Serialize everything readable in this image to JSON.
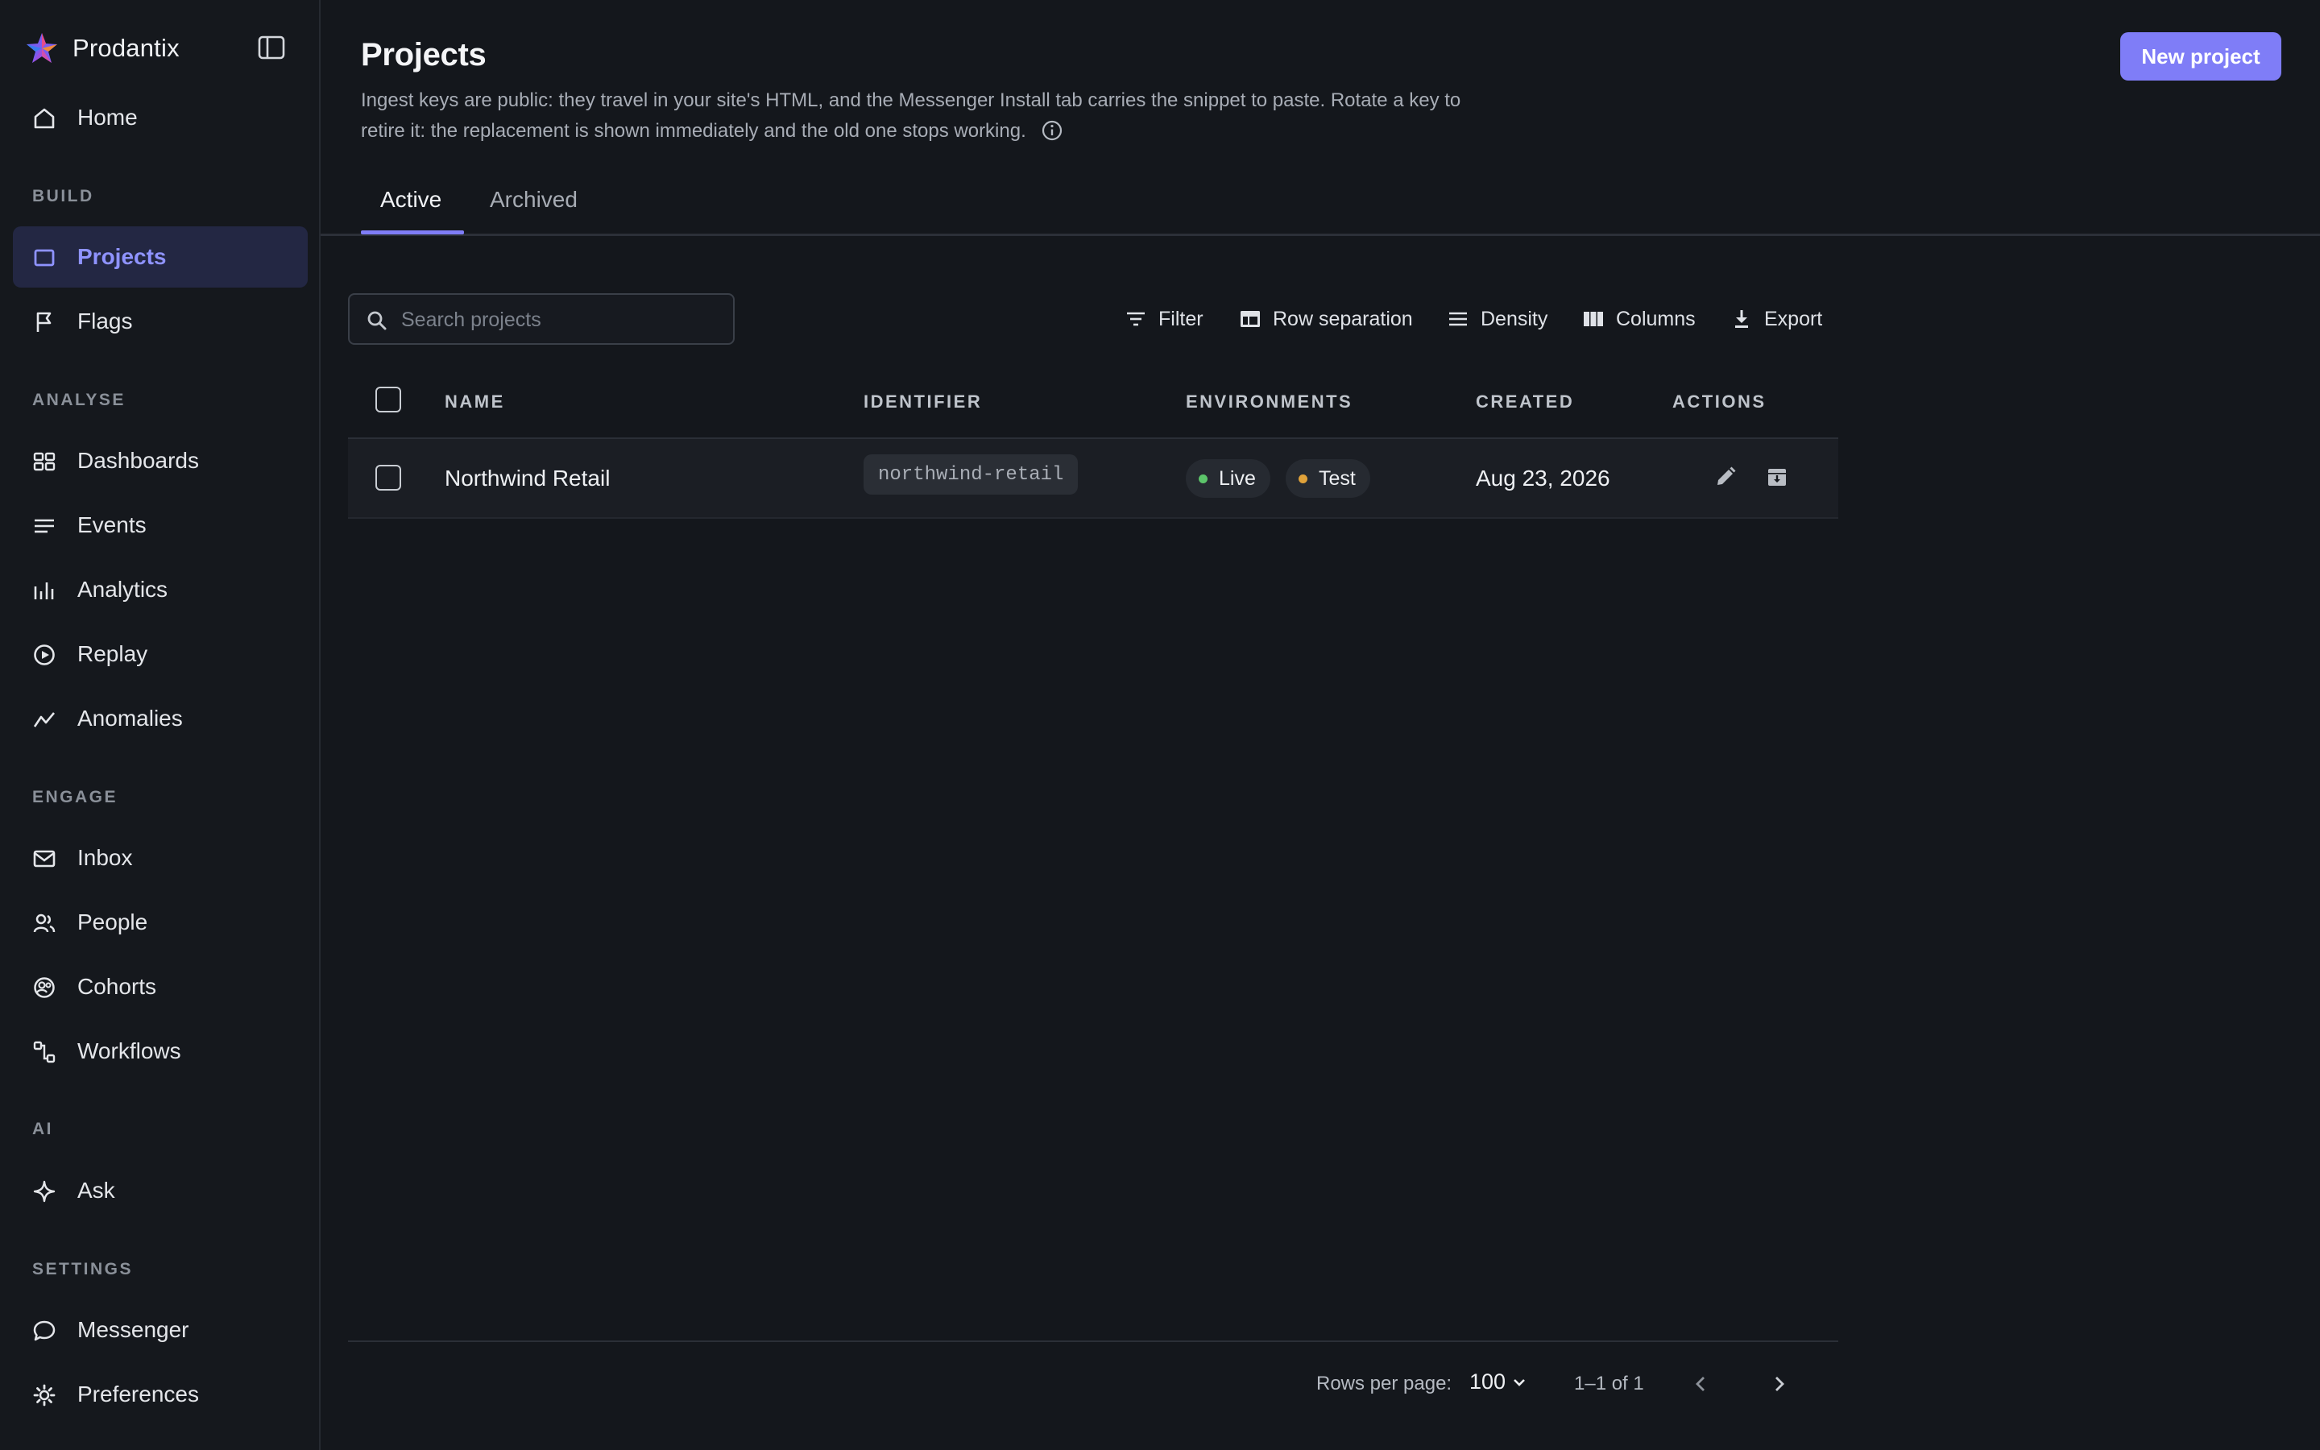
{
  "app": {
    "name": "Prodantix"
  },
  "sidebar": {
    "home": "Home",
    "sections": {
      "build": "BUILD",
      "analyse": "ANALYSE",
      "engage": "ENGAGE",
      "ai": "AI",
      "settings": "SETTINGS"
    },
    "items": {
      "projects": "Projects",
      "flags": "Flags",
      "dashboards": "Dashboards",
      "events": "Events",
      "analytics": "Analytics",
      "replay": "Replay",
      "anomalies": "Anomalies",
      "inbox": "Inbox",
      "people": "People",
      "cohorts": "Cohorts",
      "workflows": "Workflows",
      "ask": "Ask",
      "messenger": "Messenger",
      "preferences": "Preferences"
    },
    "active_item": "Projects"
  },
  "header": {
    "title": "Projects",
    "description": "Ingest keys are public: they travel in your site's HTML, and the Messenger Install tab carries the snippet to paste. Rotate a key to retire it: the replacement is shown immediately and the old one stops working.",
    "new_button": "New project"
  },
  "tabs": {
    "active": "Active",
    "archived": "Archived",
    "selected": "Active"
  },
  "toolbar": {
    "search_placeholder": "Search projects",
    "filter": "Filter",
    "row_separation": "Row separation",
    "density": "Density",
    "columns": "Columns",
    "export": "Export"
  },
  "table": {
    "headers": {
      "name": "NAME",
      "identifier": "IDENTIFIER",
      "environments": "ENVIRONMENTS",
      "created": "CREATED",
      "actions": "ACTIONS"
    },
    "rows": [
      {
        "name": "Northwind Retail",
        "identifier": "northwind-retail",
        "environments": [
          {
            "label": "Live",
            "color": "#5cc46a"
          },
          {
            "label": "Test",
            "color": "#e0a23a"
          }
        ],
        "created": "Aug 23, 2026"
      }
    ]
  },
  "pagination": {
    "rows_per_page_label": "Rows per page:",
    "rows_per_page": "100",
    "range": "1–1 of 1"
  },
  "colors": {
    "accent": "#7f7df7",
    "active_nav_bg": "#232743",
    "background": "#14171c"
  }
}
